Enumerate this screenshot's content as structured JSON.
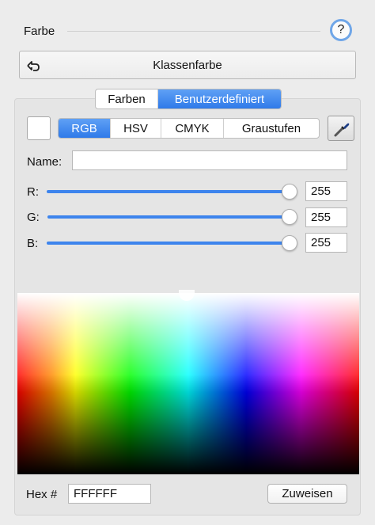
{
  "header": {
    "title": "Farbe",
    "help_label": "?"
  },
  "class_color": {
    "label": "Klassenfarbe"
  },
  "tabs": [
    {
      "label": "Farben",
      "active": false
    },
    {
      "label": "Benutzerdefiniert",
      "active": true
    }
  ],
  "color_modes": [
    {
      "label": "RGB",
      "active": true
    },
    {
      "label": "HSV",
      "active": false
    },
    {
      "label": "CMYK",
      "active": false
    },
    {
      "label": "Graustufen",
      "active": false
    }
  ],
  "current_color": "#FFFFFF",
  "name_field": {
    "label": "Name:",
    "value": ""
  },
  "channels": [
    {
      "label": "R:",
      "value": "255",
      "level": 1.0
    },
    {
      "label": "G:",
      "value": "255",
      "level": 1.0
    },
    {
      "label": "B:",
      "value": "255",
      "level": 1.0
    }
  ],
  "hex": {
    "label": "Hex #",
    "value": "FFFFFF"
  },
  "assign_button": {
    "label": "Zuweisen"
  },
  "colors": {
    "accent": "#3d84ed",
    "focus_ring": "#6fa6e8"
  }
}
